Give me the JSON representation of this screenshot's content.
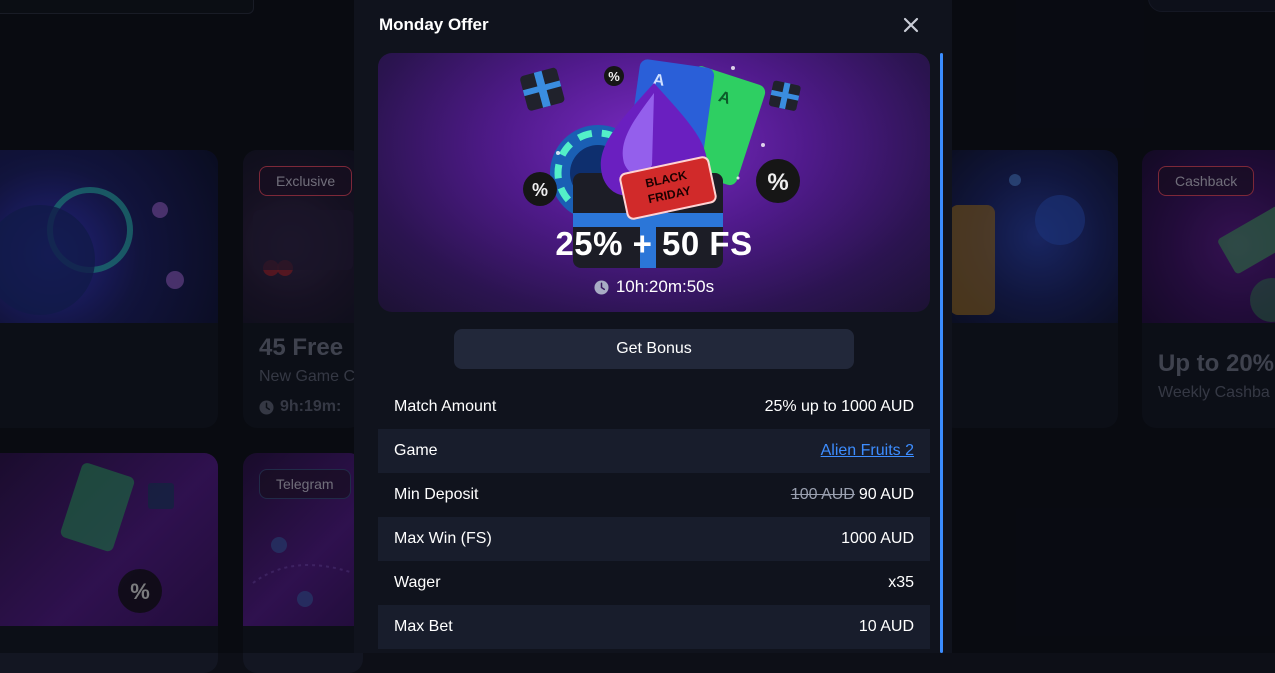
{
  "background": {
    "cards": [
      {
        "badge": "Exclusive",
        "title": "45 Free",
        "subtitle": "New Game C",
        "timer": "9h:19m:"
      },
      {
        "badge": "Cashback",
        "title": "Up to 20%",
        "subtitle": "Weekly Cashba"
      },
      {
        "badge": "Telegram"
      }
    ]
  },
  "modal": {
    "title": "Monday Offer",
    "close_icon": "close-icon",
    "hero": {
      "amount": "25% + 50 FS",
      "timer": "10h:20m:50s",
      "art_text": "BLACK FRIDAY",
      "percent_glyph": "%"
    },
    "get_bonus_label": "Get Bonus",
    "details": {
      "match_amount": {
        "label": "Match Amount",
        "value": "25% up to 1000 AUD"
      },
      "game": {
        "label": "Game",
        "value": "Alien Fruits 2"
      },
      "min_deposit": {
        "label": "Min Deposit",
        "old_value": "100 AUD",
        "value": "90 AUD"
      },
      "max_win": {
        "label": "Max Win (FS)",
        "value": "1000 AUD"
      },
      "wager": {
        "label": "Wager",
        "value": "x35"
      },
      "max_bet": {
        "label": "Max Bet",
        "value": "10 AUD"
      }
    }
  },
  "colors": {
    "accent_link": "#3d8dff",
    "badge_exclusive": "#e0445e",
    "badge_cashback": "#e0445e",
    "badge_telegram": "#3a4a7a"
  }
}
